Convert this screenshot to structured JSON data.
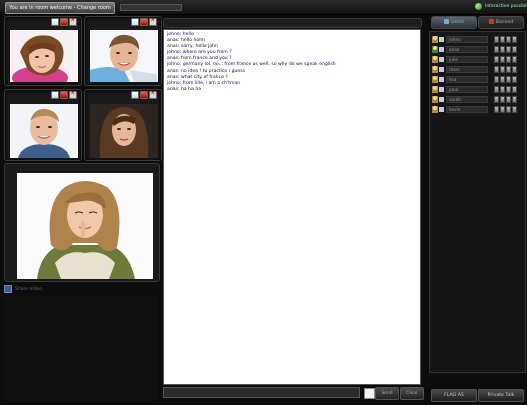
{
  "topbar": {
    "welcome_button": "You are in room welcome - Change room",
    "online_label": "Interactive possible"
  },
  "tiles": [
    {
      "name": "top-left"
    },
    {
      "name": "top-right"
    },
    {
      "name": "middle-left"
    },
    {
      "name": "middle-right"
    }
  ],
  "share": {
    "label": "Share Video"
  },
  "chat": {
    "lines": [
      {
        "user": "johno",
        "text": "johno: hello"
      },
      {
        "user": "anas",
        "text": "anas: hello hohn"
      },
      {
        "user": "anas",
        "text": "anas: sorry, hello john"
      },
      {
        "user": "johno",
        "text": "johno: where are you from ?"
      },
      {
        "user": "anas",
        "text": "anas: from france and you ?"
      },
      {
        "user": "johno",
        "text": "johno: germany lol, no... from france as well, so why do we  speak english"
      },
      {
        "user": "anas",
        "text": "anas: no idea ! to practice i guess"
      },
      {
        "user": "anas",
        "text": "anas: what city of france ?"
      },
      {
        "user": "johno",
        "text": "johno: from lille, i am a ch'tman"
      },
      {
        "user": "anas",
        "text": "anas: ha ha ha"
      }
    ],
    "input_value": "",
    "send_label": "Send",
    "clear_label": "Clear"
  },
  "right_panel": {
    "tabs": [
      {
        "label": "Users"
      },
      {
        "label": "Banned"
      }
    ],
    "users": [
      {
        "name": "johno",
        "color": "#b08a3a"
      },
      {
        "name": "anas",
        "color": "#2f8a3a"
      },
      {
        "name": "julie",
        "color": "#b08a3a"
      },
      {
        "name": "marc",
        "color": "#b08a3a"
      },
      {
        "name": "lisa",
        "color": "#b08a3a"
      },
      {
        "name": "paul",
        "color": "#b08a3a"
      },
      {
        "name": "sarah",
        "color": "#b08a3a"
      },
      {
        "name": "kevin",
        "color": "#b08a3a"
      }
    ],
    "flag_label": "FLAG AS",
    "private_label": "Private Talk"
  }
}
